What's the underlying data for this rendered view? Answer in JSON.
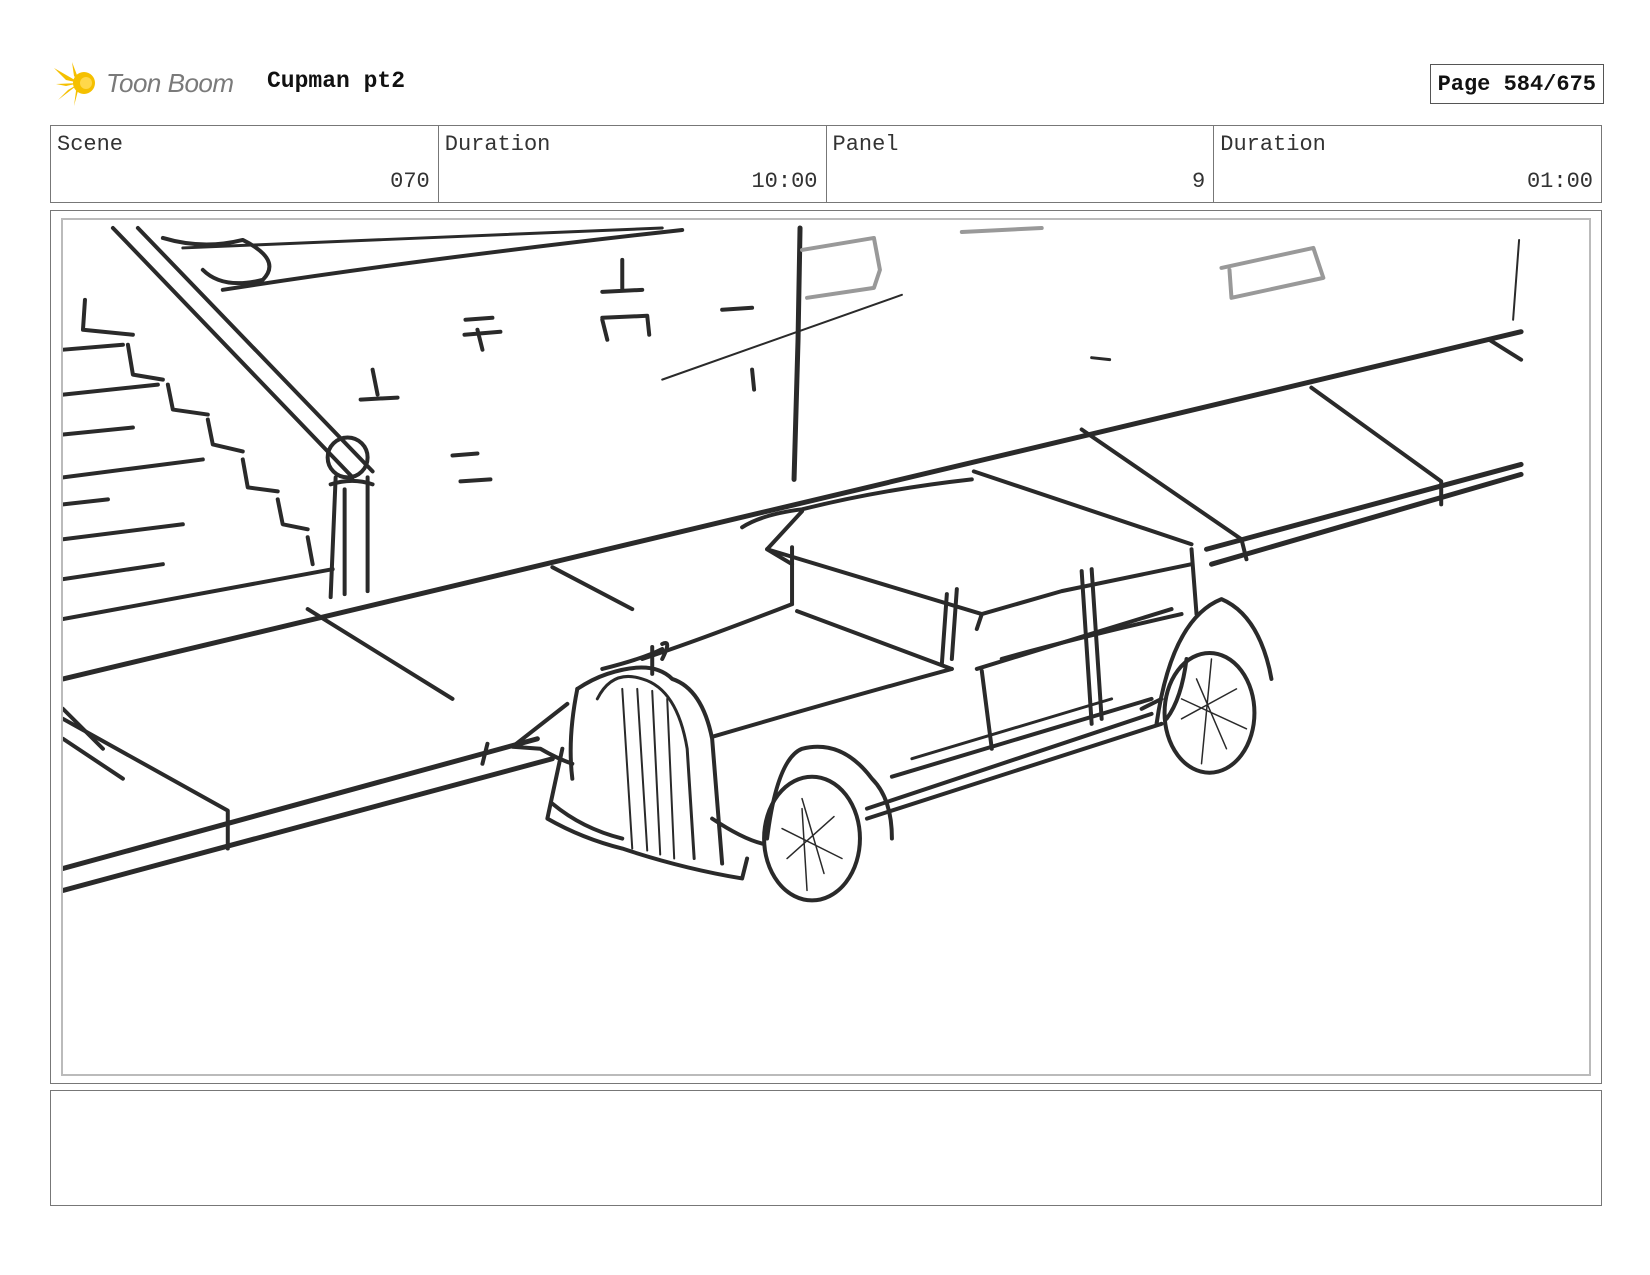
{
  "header": {
    "logo_text": "Toon Boom",
    "title": "Cupman pt2",
    "page_label": "Page 584/675"
  },
  "info": {
    "scene_label": "Scene",
    "scene_value": "070",
    "scene_duration_label": "Duration",
    "scene_duration_value": "10:00",
    "panel_label": "Panel",
    "panel_value": "9",
    "panel_duration_label": "Duration",
    "panel_duration_value": "01:00"
  },
  "notes": {
    "text": ""
  },
  "colors": {
    "sketch_stroke": "#2a2a2a",
    "sketch_light": "#999999",
    "logo_yellow": "#f5c000",
    "border": "#777777"
  }
}
